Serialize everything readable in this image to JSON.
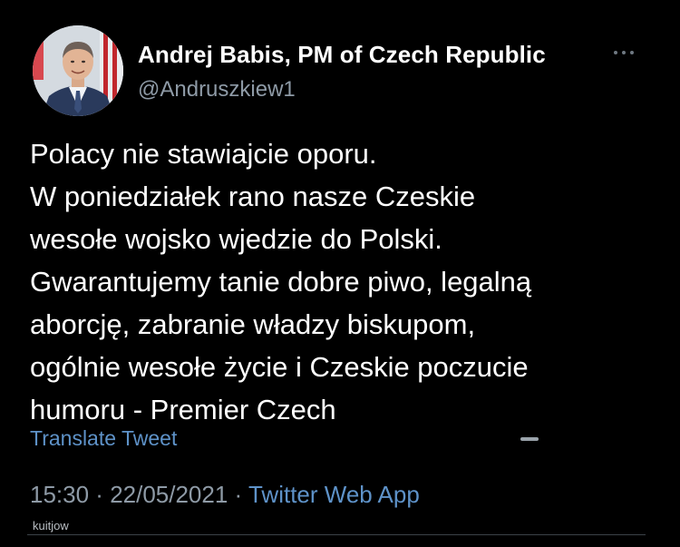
{
  "author": {
    "display_name": "Andrej Babis, PM of Czech Republic",
    "handle": "@Andruszkiew1"
  },
  "tweet": {
    "lines": [
      "Polacy nie stawiajcie oporu.",
      "W poniedziałek rano nasze Czeskie",
      "wesołe wojsko wjedzie do Polski.",
      "Gwarantujemy tanie dobre piwo, legalną",
      "aborcję, zabranie władzy biskupom,",
      "ogólnie wesołe życie i Czeskie poczucie",
      "humoru - Premier Czech"
    ],
    "translate_label": "Translate Tweet"
  },
  "meta": {
    "time": "15:30",
    "separator": " · ",
    "date": "22/05/2021",
    "source": "Twitter Web App"
  },
  "watermark": "kuitjow",
  "icons": {
    "more": "more-horizontal-icon",
    "avatar": "profile-photo"
  },
  "colors": {
    "background": "#000000",
    "text_primary": "#ffffff",
    "text_secondary": "#8e9aa6",
    "link": "#5e92c8"
  }
}
